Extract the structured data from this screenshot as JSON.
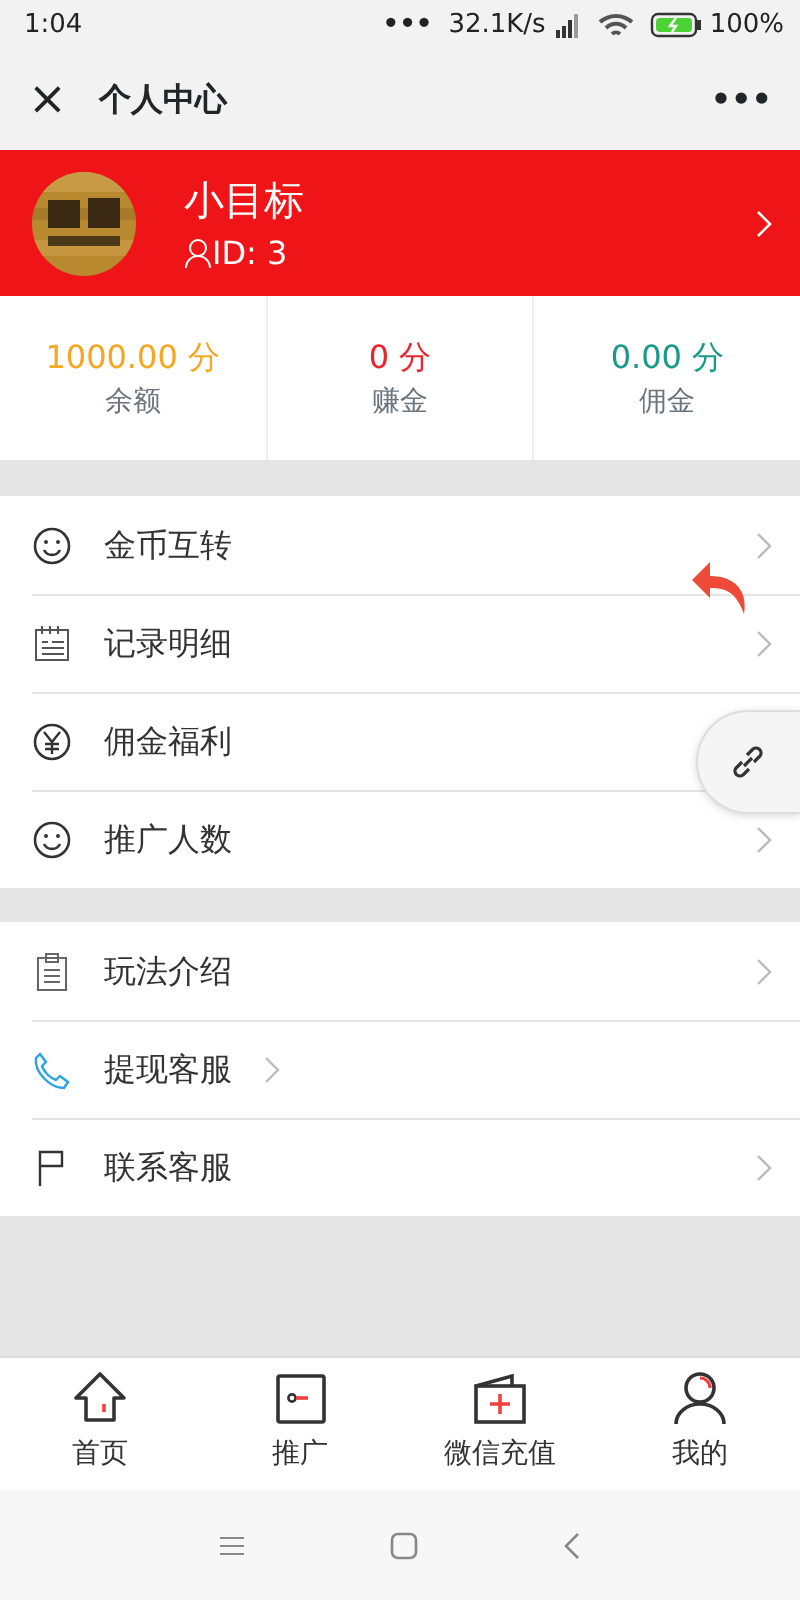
{
  "status_bar": {
    "time": "1:04",
    "dots": "•••",
    "speed": "32.1K/s",
    "battery": "100%"
  },
  "header": {
    "close": "×",
    "title": "个人中心",
    "more": "•••"
  },
  "profile": {
    "name": "小目标",
    "id": "ID: 3"
  },
  "stats": [
    {
      "value": "1000.00 分",
      "label": "余额",
      "color": "#f5a623"
    },
    {
      "value": "0 分",
      "label": "赚金",
      "color": "#e8262b"
    },
    {
      "value": "0.00 分",
      "label": "佣金",
      "color": "#1a9a88"
    }
  ],
  "menu_groups": [
    [
      {
        "label": "金币互转",
        "kind": "row"
      },
      {
        "label": "记录明细",
        "kind": "row"
      },
      {
        "label": "佣金福利",
        "kind": "plain"
      },
      {
        "label": "推广人数",
        "kind": "row"
      }
    ],
    [
      {
        "label": "玩法介绍",
        "kind": "row"
      },
      {
        "label": "提现客服",
        "kind": "inline"
      },
      {
        "label": "联系客服",
        "kind": "row"
      }
    ]
  ],
  "tab_bar": [
    {
      "label": "首页"
    },
    {
      "label": "推广"
    },
    {
      "label": "微信充值"
    },
    {
      "label": "我的"
    }
  ]
}
